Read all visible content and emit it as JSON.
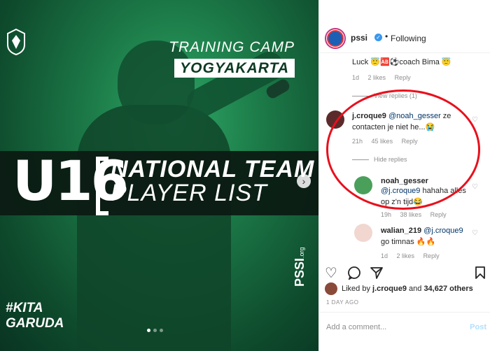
{
  "post": {
    "header_line": "TRAINING CAMP",
    "city": "YOGYAKARTA",
    "big_number": "U16",
    "title_line1": "NATIONAL TEAM",
    "title_line2": "PLAYER LIST",
    "hashtag_line1": "#KITA",
    "hashtag_line2": "GARUDA",
    "brand": "PSSI",
    "brand_suffix": ".org",
    "next_icon": "chevron-right-icon",
    "carousel_count": 3,
    "carousel_active": 0
  },
  "profile": {
    "username": "pssi",
    "separator": "•",
    "follow_status": "Following"
  },
  "comments": [
    {
      "text": "Luck 😇🆎⚽coach Bima 😇",
      "time": "1d",
      "likes": "2 likes",
      "reply": "Reply",
      "view_replies": "View replies (1)"
    },
    {
      "user": "j.croque9",
      "mention": "@noah_gesser",
      "text_line1": " ze",
      "text_line2": "contacten je niet he...😭",
      "time": "21h",
      "likes": "45 likes",
      "reply": "Reply",
      "hide_replies": "Hide replies"
    },
    {
      "user": "noah_gesser",
      "mention": "@j.croque9",
      "text_line1": " hahaha alles",
      "text_line2": "op z'n tijd😂",
      "time": "19h",
      "likes": "38 likes",
      "reply": "Reply"
    },
    {
      "user": "walian_219",
      "mention": "@j.croque9",
      "text_line2": "go timnas 🔥🔥",
      "time": "1d",
      "likes": "2 likes",
      "reply": "Reply"
    }
  ],
  "likes": {
    "prefix": "Liked by",
    "user": "j.croque9",
    "middle": "and",
    "count": "34,627 others"
  },
  "date": "1 DAY AGO",
  "add_comment": {
    "placeholder": "Add a comment...",
    "post_label": "Post"
  },
  "colors": {
    "annotation": "#e8101c",
    "link": "#3897f0",
    "post_disabled": "#b2dffc",
    "image_green": "#1c7a48"
  }
}
